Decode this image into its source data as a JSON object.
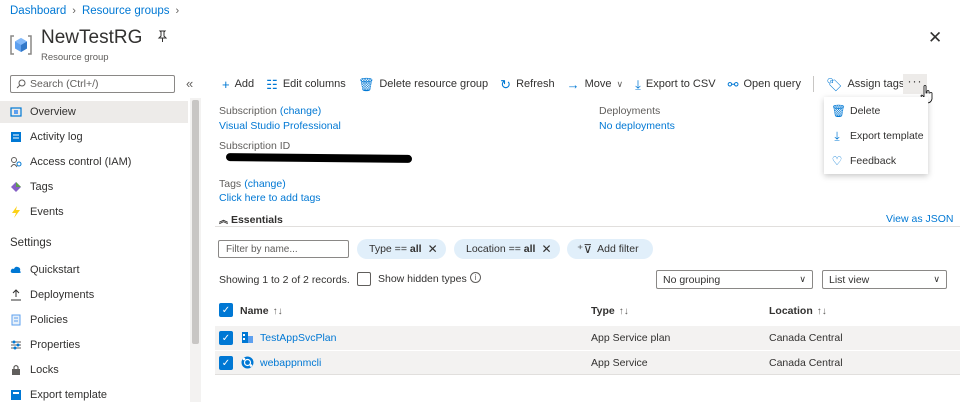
{
  "breadcrumb": [
    "Dashboard",
    "Resource groups"
  ],
  "header": {
    "title": "NewTestRG",
    "subtitle": "Resource group"
  },
  "sidebar": {
    "search_placeholder": "Search (Ctrl+/)",
    "items": [
      {
        "label": "Overview",
        "icon": "overview-icon"
      },
      {
        "label": "Activity log",
        "icon": "activity-log-icon"
      },
      {
        "label": "Access control (IAM)",
        "icon": "iam-icon"
      },
      {
        "label": "Tags",
        "icon": "tag-icon"
      },
      {
        "label": "Events",
        "icon": "lightning-icon"
      }
    ],
    "settings_label": "Settings",
    "settings_items": [
      {
        "label": "Quickstart",
        "icon": "cloud-icon"
      },
      {
        "label": "Deployments",
        "icon": "upload-icon"
      },
      {
        "label": "Policies",
        "icon": "policy-icon"
      },
      {
        "label": "Properties",
        "icon": "sliders-icon"
      },
      {
        "label": "Locks",
        "icon": "lock-icon"
      },
      {
        "label": "Export template",
        "icon": "export-template-icon"
      }
    ]
  },
  "toolbar": {
    "add": "Add",
    "edit_columns": "Edit columns",
    "delete_rg": "Delete resource group",
    "refresh": "Refresh",
    "move": "Move",
    "export_csv": "Export to CSV",
    "open_query": "Open query",
    "assign_tags": "Assign tags",
    "more": "···"
  },
  "more_menu": [
    "Delete",
    "Export template",
    "Feedback"
  ],
  "essentials": {
    "subscription_label": "Subscription",
    "change": "(change)",
    "subscription_value": "Visual Studio Professional",
    "subscription_id_label": "Subscription ID",
    "deployments_label": "Deployments",
    "deployments_value": "No deployments",
    "tags_label": "Tags",
    "tags_value": "Click here to add tags",
    "toggle_label": "Essentials",
    "view_json": "View as JSON"
  },
  "filters": {
    "name_placeholder": "Filter by name...",
    "type_pill": {
      "prefix": "Type == ",
      "value": "all"
    },
    "location_pill": {
      "prefix": "Location == ",
      "value": "all"
    },
    "add_filter": "Add filter"
  },
  "records": {
    "summary": "Showing 1 to 2 of 2 records.",
    "show_hidden": "Show hidden types"
  },
  "grouping": {
    "value": "No grouping"
  },
  "view": {
    "value": "List view"
  },
  "table": {
    "columns": [
      "Name",
      "Type",
      "Location"
    ],
    "sort_glyph": "↑↓",
    "rows": [
      {
        "name": "TestAppSvcPlan",
        "type": "App Service plan",
        "location": "Canada Central",
        "icon": "app-service-plan-icon"
      },
      {
        "name": "webappnmcli",
        "type": "App Service",
        "location": "Canada Central",
        "icon": "app-service-icon"
      }
    ]
  },
  "colors": {
    "accent": "#0078d4",
    "selected_row": "#f3f2f1",
    "pill": "#e1effa"
  }
}
